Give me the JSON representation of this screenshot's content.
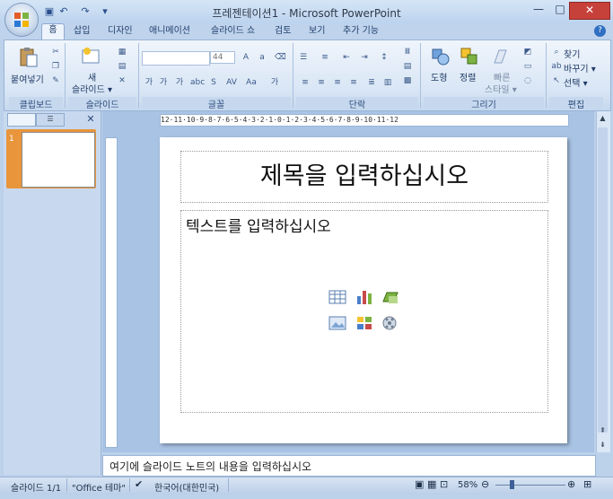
{
  "window": {
    "title": "프레젠테이션1 - Microsoft PowerPoint",
    "controls": {
      "minimize": "—",
      "restore": "□",
      "close": "✕"
    }
  },
  "quick_access": [
    {
      "name": "save-icon",
      "glyph": "▣"
    },
    {
      "name": "undo-icon",
      "glyph": "↶"
    },
    {
      "name": "redo-icon",
      "glyph": "↷"
    },
    {
      "name": "customize-icon",
      "glyph": "▾"
    }
  ],
  "tabs": [
    "홈",
    "삽입",
    "디자인",
    "애니메이션",
    "슬라이드 쇼",
    "검토",
    "보기",
    "추가 기능"
  ],
  "ribbon": {
    "clipboard": {
      "paste": "붙여넣기",
      "group": "클립보드"
    },
    "slides": {
      "new_slide_line1": "새",
      "new_slide_line2": "슬라이드 ▾",
      "group": "슬라이드"
    },
    "font": {
      "size": "44",
      "group": "글꼴",
      "buttons": [
        "가",
        "가",
        "가",
        "abc",
        "S",
        "AV",
        "Aa",
        "가"
      ]
    },
    "paragraph": {
      "group": "단락"
    },
    "drawing": {
      "shapes": "도형",
      "arrange": "정렬",
      "quick_styles_line1": "빠른",
      "quick_styles_line2": "스타일 ▾",
      "group": "그리기"
    },
    "editing": {
      "find": "찾기",
      "replace": "바꾸기 ▾",
      "select": "선택 ▾",
      "group": "편집"
    }
  },
  "slides_panel": {
    "slide_number": "1"
  },
  "ruler": {
    "horizontal": "12·11·10·9·8·7·6·5·4·3·2·1·0·1·2·3·4·5·6·7·8·9·10·11·12"
  },
  "slide": {
    "title_placeholder": "제목을 입력하십시오",
    "body_placeholder": "텍스트를 입력하십시오"
  },
  "notes": {
    "placeholder": "여기에 슬라이드 노트의 내용을 입력하십시오"
  },
  "status": {
    "slide_count": "슬라이드 1/1",
    "theme": "\"Office 테마\"",
    "language": "한국어(대한민국)",
    "zoom": "58%"
  },
  "colors": {
    "accent": "#e8953b",
    "ribbon": "#d9e6f5",
    "titlebar": "#bcd3ee",
    "close": "#c7413b"
  }
}
